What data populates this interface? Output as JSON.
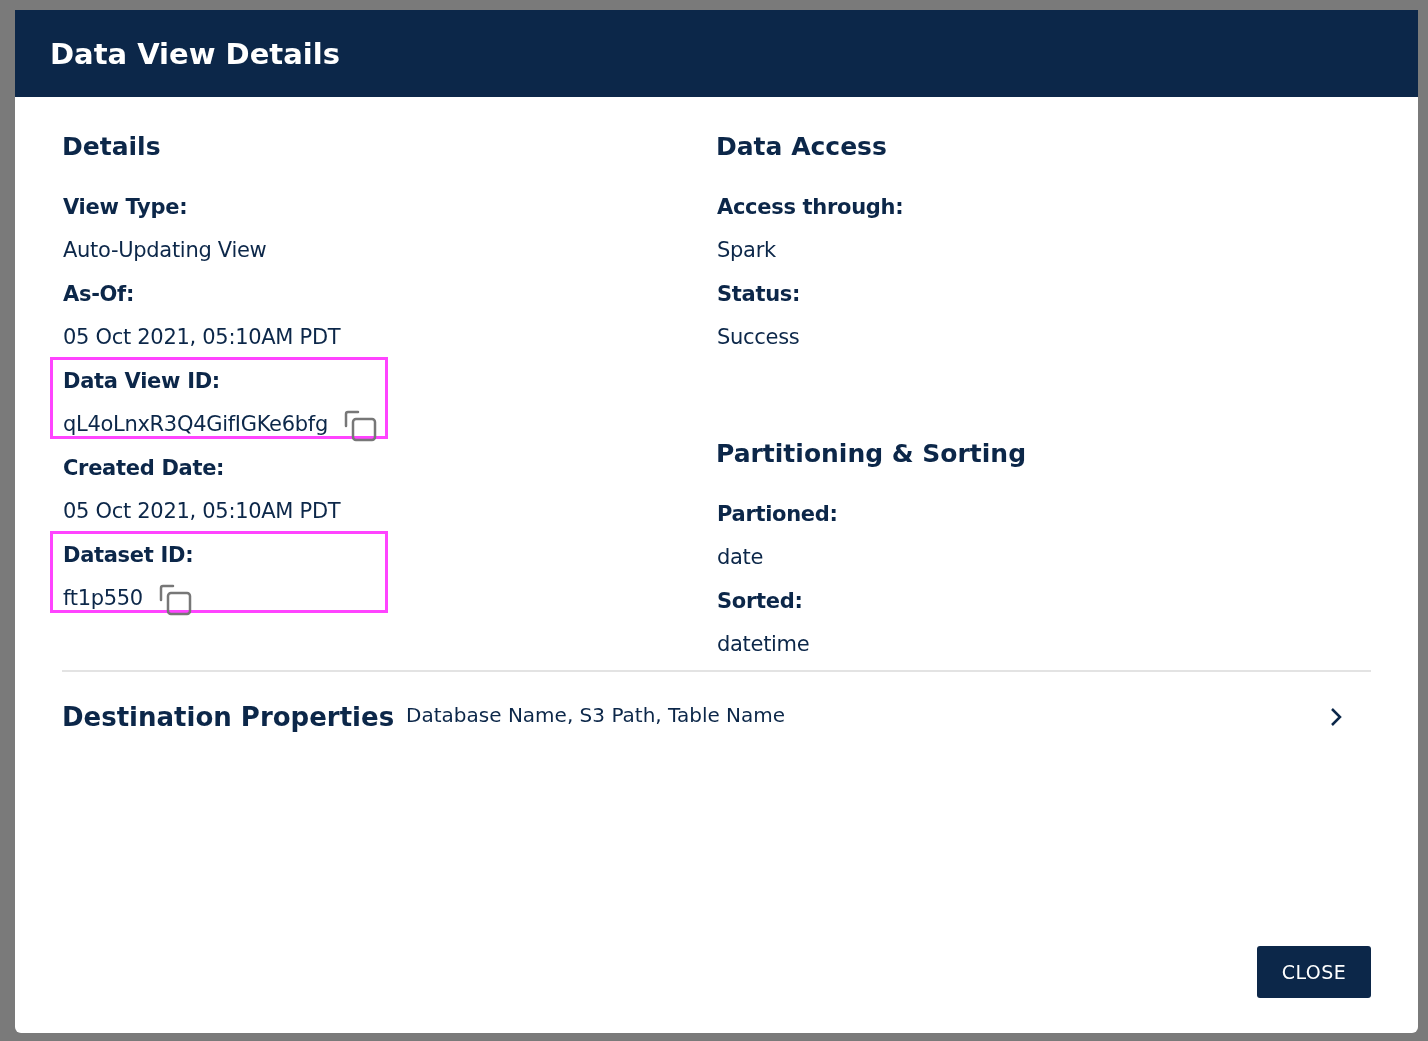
{
  "dialog": {
    "title": "Data View Details",
    "columns": [
      {
        "sections": [
          {
            "heading": "Details",
            "fields": [
              {
                "label": "View Type:",
                "value": "Auto-Updating View",
                "copyable": false,
                "highlighted": false
              },
              {
                "label": "As-Of:",
                "value": "05 Oct 2021, 05:10AM PDT",
                "copyable": false,
                "highlighted": false
              },
              {
                "label": "Data View ID:",
                "value": "qL4oLnxR3Q4GifIGKe6bfg",
                "copyable": true,
                "highlighted": true
              },
              {
                "label": "Created Date:",
                "value": "05 Oct 2021, 05:10AM PDT",
                "copyable": false,
                "highlighted": false
              },
              {
                "label": "Dataset ID:",
                "value": "ft1p550",
                "copyable": true,
                "highlighted": true
              }
            ]
          }
        ]
      },
      {
        "sections": [
          {
            "heading": "Data Access",
            "fields": [
              {
                "label": "Access through:",
                "value": "Spark",
                "copyable": false,
                "highlighted": false
              },
              {
                "label": "Status:",
                "value": "Success",
                "copyable": false,
                "highlighted": false
              }
            ]
          },
          {
            "heading": "Partitioning & Sorting",
            "fields": [
              {
                "label": "Partioned:",
                "value": "date",
                "copyable": false,
                "highlighted": false
              },
              {
                "label": "Sorted:",
                "value": "datetime",
                "copyable": false,
                "highlighted": false
              }
            ]
          }
        ]
      }
    ],
    "destination": {
      "title": "Destination Properties",
      "summary": "Database Name, S3 Path, Table Name",
      "expanded": false
    },
    "buttons": [
      "CLOSE"
    ]
  }
}
